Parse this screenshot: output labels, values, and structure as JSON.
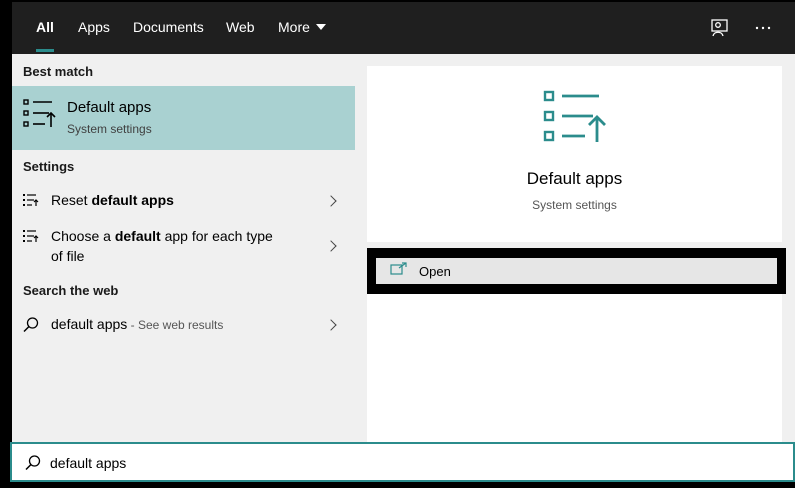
{
  "tabs": [
    {
      "label": "All",
      "active": true
    },
    {
      "label": "Apps"
    },
    {
      "label": "Documents"
    },
    {
      "label": "Web"
    },
    {
      "label": "More"
    }
  ],
  "topbar_icons": [
    "feedback-icon",
    "more-options-icon"
  ],
  "best_match": {
    "header": "Best match",
    "title": "Default apps",
    "subtitle": "System settings",
    "icon": "default-apps-icon"
  },
  "settings": {
    "header": "Settings",
    "items": [
      {
        "pre": "Reset ",
        "bold": "default apps",
        "post": ""
      },
      {
        "pre": "Choose a ",
        "bold": "default",
        "post": " app for each type",
        "line2": "of file"
      }
    ]
  },
  "web": {
    "header": "Search the web",
    "query": "default apps",
    "suffix": " - See web results"
  },
  "preview": {
    "title": "Default apps",
    "subtitle": "System settings",
    "open_label": "Open"
  },
  "search": {
    "value": "default apps"
  },
  "colors": {
    "accent": "#2b8c8c",
    "selection": "#a9d1d1",
    "topbar": "#1f1f1f",
    "pane": "#f0f0f0"
  }
}
